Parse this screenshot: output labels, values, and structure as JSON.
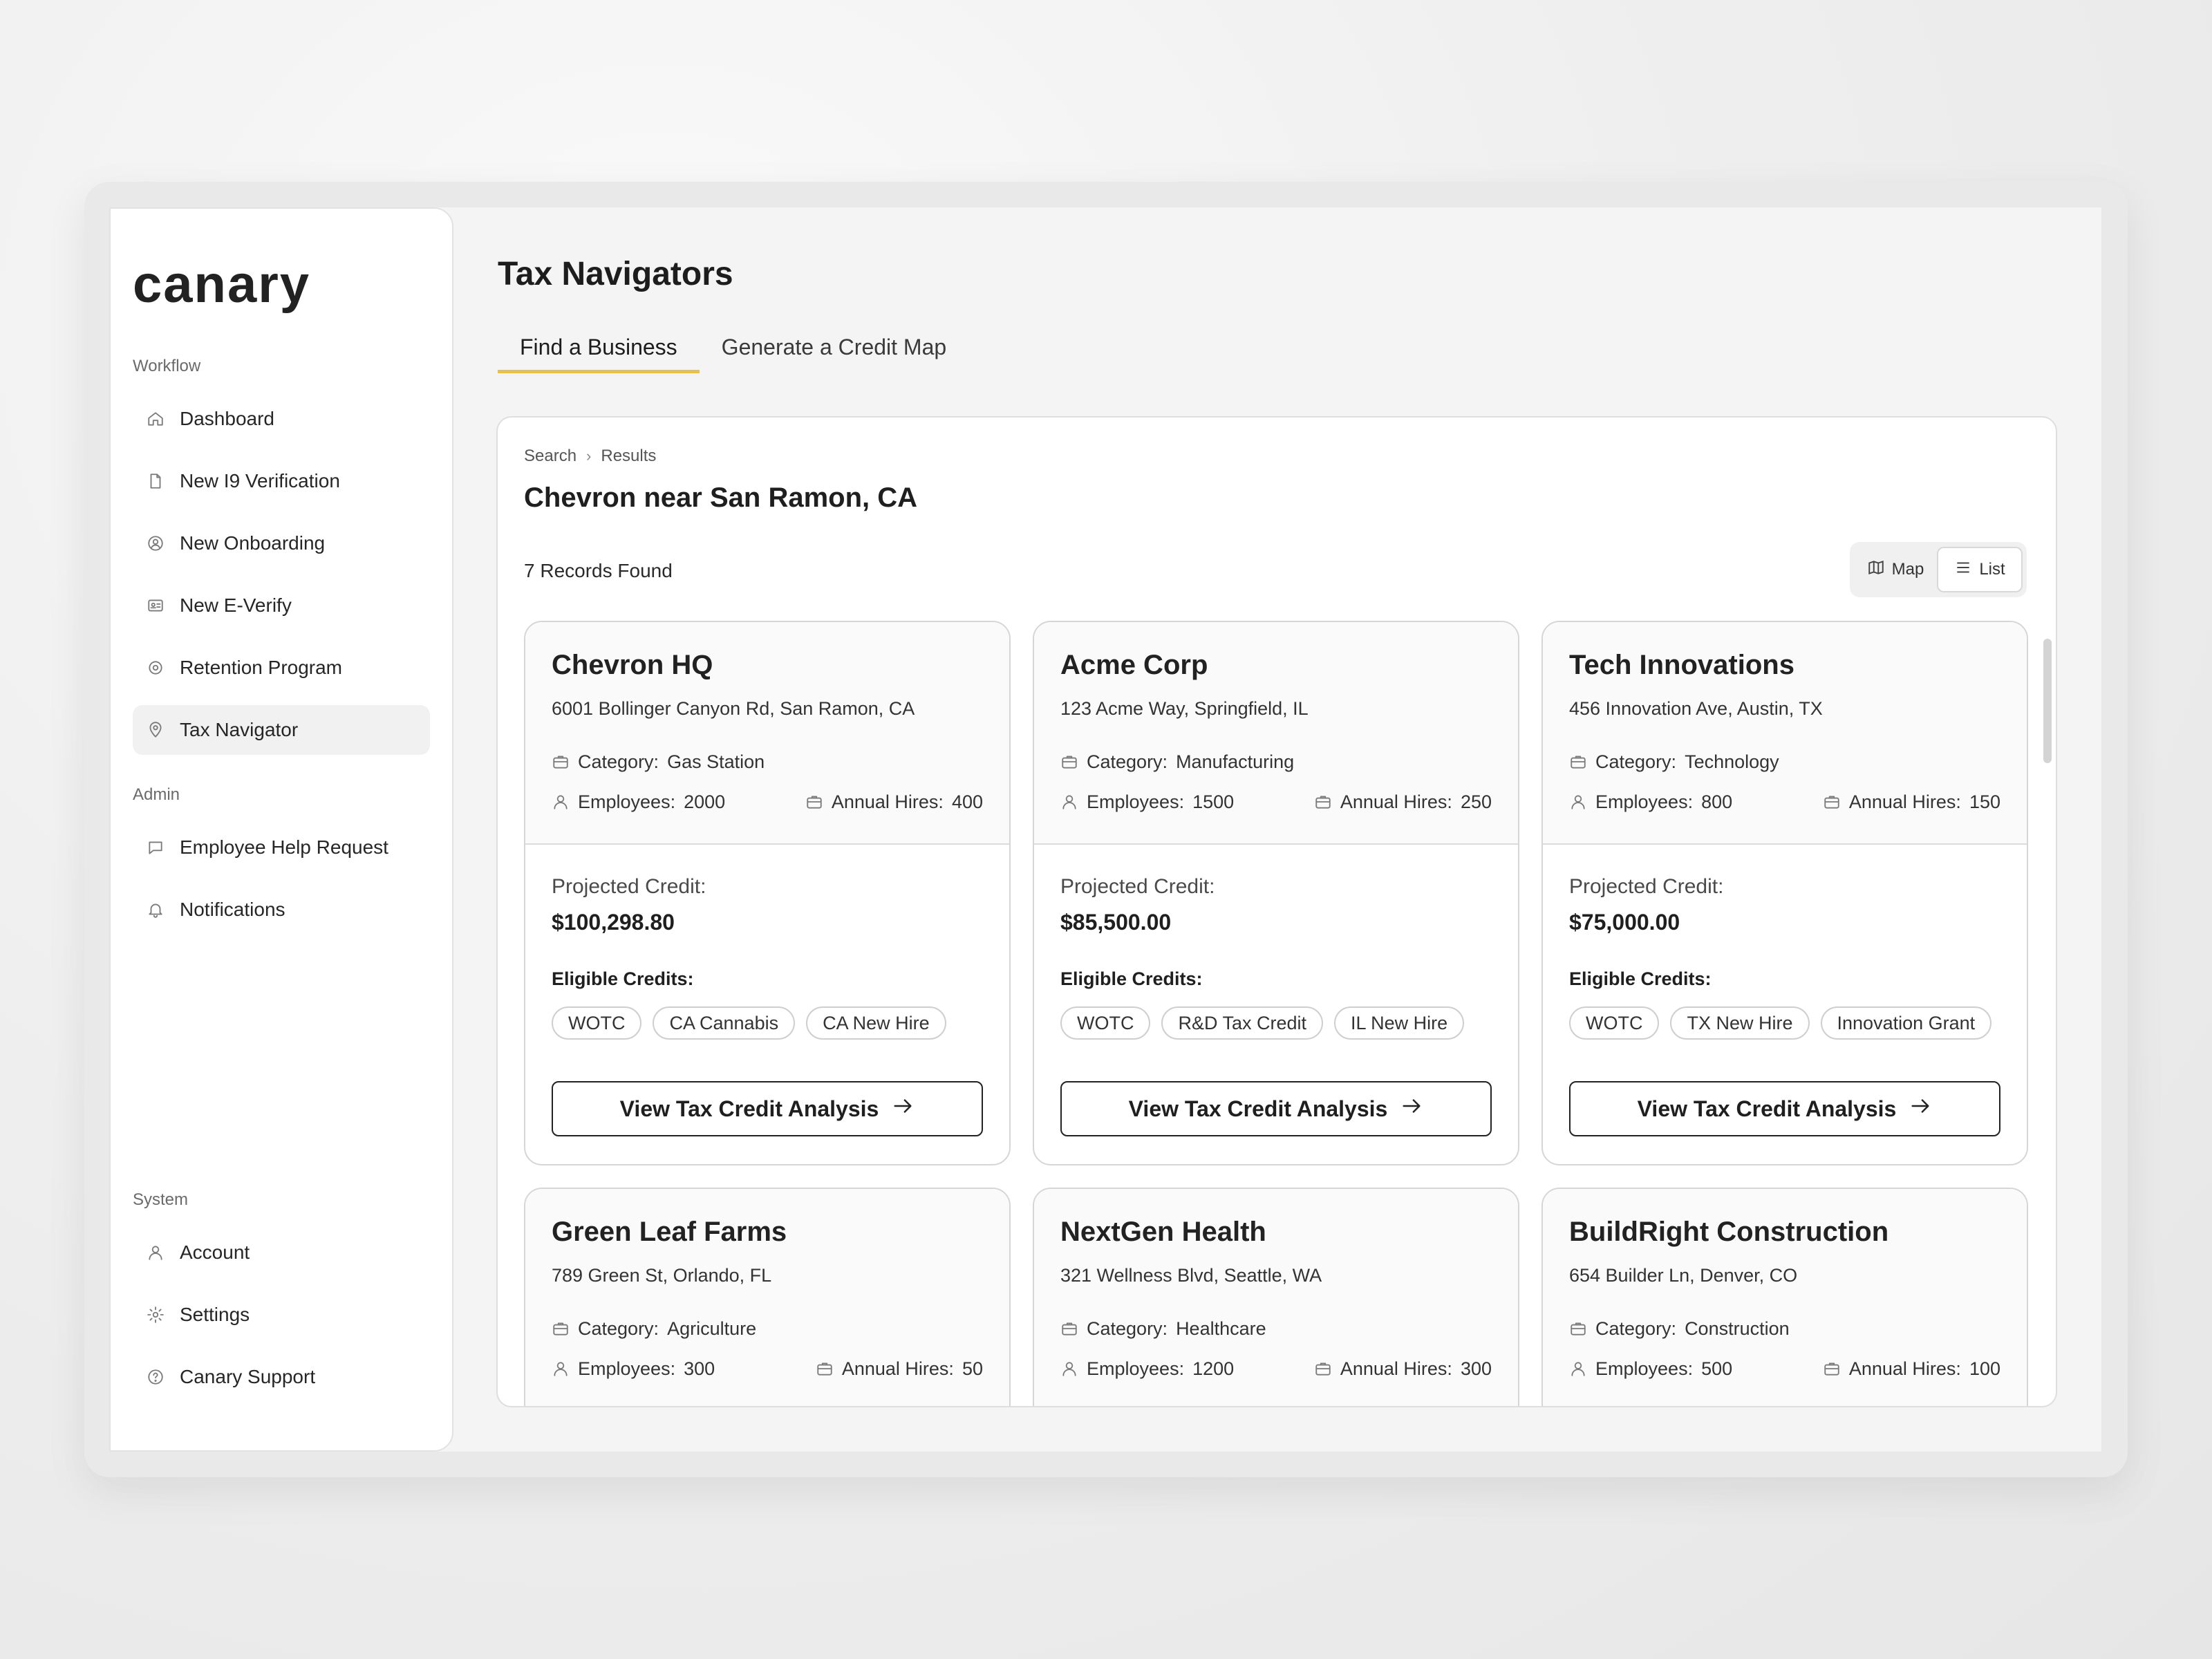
{
  "app": {
    "logo_text": "canary"
  },
  "sidebar": {
    "workflow_label": "Workflow",
    "workflow_items": [
      {
        "label": "Dashboard",
        "icon": "home-icon"
      },
      {
        "label": "New I9 Verification",
        "icon": "document-icon"
      },
      {
        "label": "New Onboarding",
        "icon": "user-circle-icon"
      },
      {
        "label": "New E-Verify",
        "icon": "id-card-icon"
      },
      {
        "label": "Retention Program",
        "icon": "refresh-icon"
      },
      {
        "label": "Tax Navigator",
        "icon": "map-pin-icon"
      }
    ],
    "admin_label": "Admin",
    "admin_items": [
      {
        "label": "Employee Help Request",
        "icon": "chat-icon"
      },
      {
        "label": "Notifications",
        "icon": "bell-icon"
      }
    ],
    "system_label": "System",
    "system_items": [
      {
        "label": "Account",
        "icon": "user-icon"
      },
      {
        "label": "Settings",
        "icon": "gear-icon"
      },
      {
        "label": "Canary Support",
        "icon": "help-icon"
      }
    ]
  },
  "main": {
    "title": "Tax Navigators",
    "tabs": [
      {
        "label": "Find a  Business"
      },
      {
        "label": "Generate a Credit Map"
      }
    ],
    "breadcrumb": {
      "first": "Search",
      "second": "Results"
    },
    "results_title": "Chevron near San Ramon, CA",
    "records_found": "7 Records Found",
    "view_toggle": {
      "map": "Map",
      "list": "List"
    }
  },
  "card_labels": {
    "category": "Category:",
    "employees": "Employees:",
    "annual_hires": "Annual Hires:",
    "projected_credit": "Projected Credit:",
    "eligible_credits": "Eligible Credits:",
    "cta": "View Tax Credit Analysis"
  },
  "cards": [
    {
      "name": "Chevron HQ",
      "address": "6001 Bollinger Canyon Rd, San Ramon, CA",
      "category": "Gas Station",
      "employees": "2000",
      "annual_hires": "400",
      "projected_credit": "$100,298.80",
      "credits": [
        "WOTC",
        "CA Cannabis",
        "CA New Hire"
      ]
    },
    {
      "name": "Acme Corp",
      "address": "123 Acme Way, Springfield, IL",
      "category": "Manufacturing",
      "employees": "1500",
      "annual_hires": "250",
      "projected_credit": "$85,500.00",
      "credits": [
        "WOTC",
        "R&D Tax Credit",
        "IL New Hire"
      ]
    },
    {
      "name": "Tech Innovations",
      "address": "456 Innovation Ave, Austin, TX",
      "category": "Technology",
      "employees": "800",
      "annual_hires": "150",
      "projected_credit": "$75,000.00",
      "credits": [
        "WOTC",
        "TX New Hire",
        "Innovation Grant"
      ]
    },
    {
      "name": "Green Leaf Farms",
      "address": "789 Green St, Orlando, FL",
      "category": "Agriculture",
      "employees": "300",
      "annual_hires": "50",
      "projected_credit": "",
      "credits": []
    },
    {
      "name": "NextGen Health",
      "address": "321 Wellness Blvd, Seattle, WA",
      "category": "Healthcare",
      "employees": "1200",
      "annual_hires": "300",
      "projected_credit": "",
      "credits": []
    },
    {
      "name": "BuildRight Construction",
      "address": "654 Builder Ln, Denver, CO",
      "category": "Construction",
      "employees": "500",
      "annual_hires": "100",
      "projected_credit": "",
      "credits": []
    }
  ]
}
